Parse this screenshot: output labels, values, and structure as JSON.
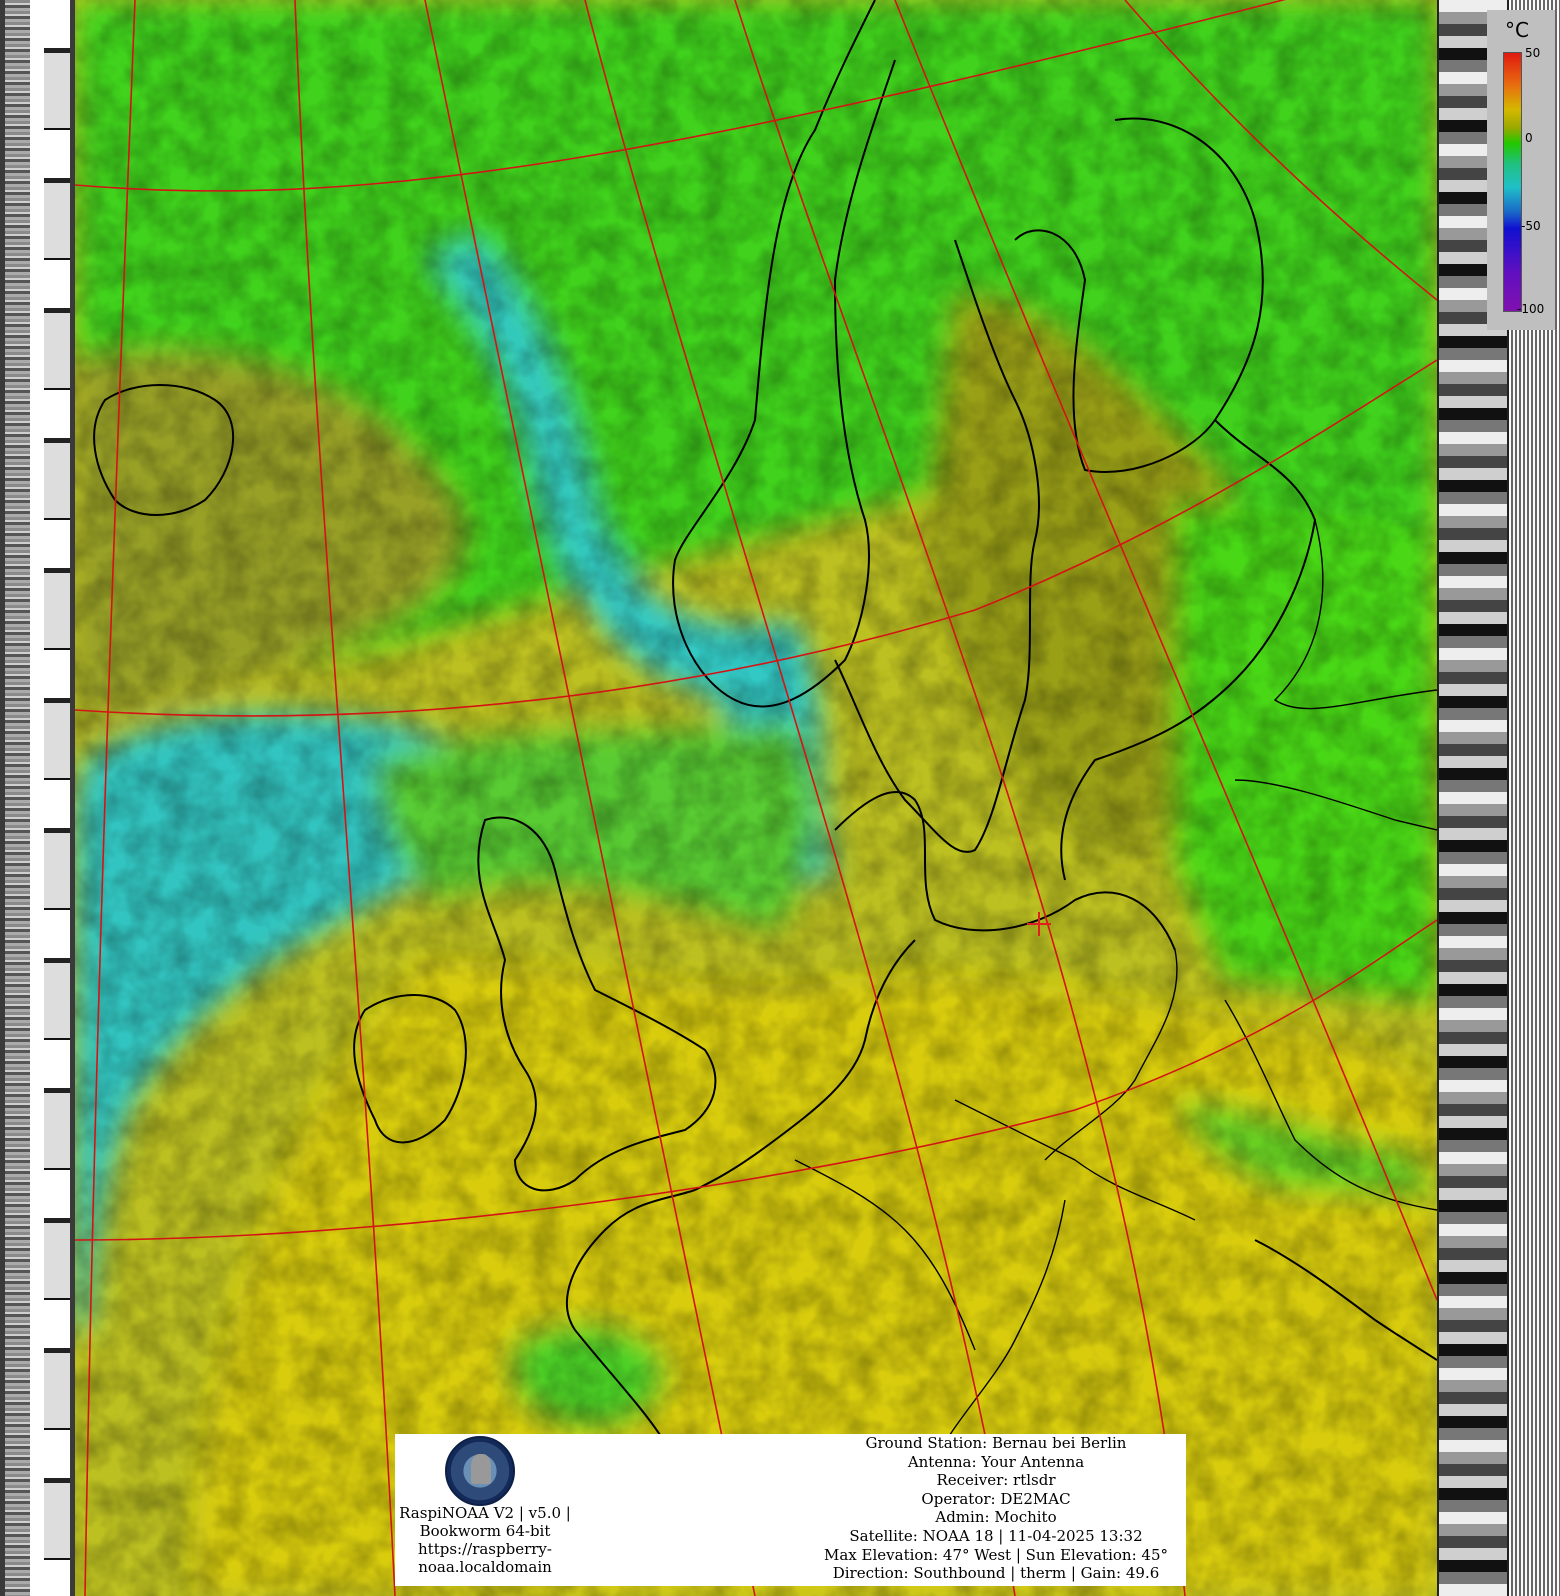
{
  "legend": {
    "unit": "°C",
    "ticks": [
      "50",
      "0",
      "-50",
      "-100"
    ],
    "color_scale": [
      "#e01a10",
      "#d4b800",
      "#22c800",
      "#20c0c8",
      "#1a64c8",
      "#8010b0"
    ]
  },
  "info": {
    "software": "RaspiNOAA V2 | v5.0 |",
    "os": "Bookworm 64-bit",
    "url_line1": "https://raspberry-",
    "url_line2": "noaa.localdomain",
    "ground_station": "Ground Station: Bernau bei Berlin",
    "antenna": "Antenna: Your Antenna",
    "receiver": "Receiver: rtlsdr",
    "operator": "Operator: DE2MAC",
    "admin": "Admin: Mochito",
    "satellite": "Satellite: NOAA 18 | 11-04-2025 13:32",
    "elevation": "Max Elevation: 47° West | Sun Elevation: 45°",
    "direction": "Direction: Southbound | therm | Gain: 49.6"
  },
  "colors": {
    "warm_yellow": "#d4c80a",
    "olive": "#9aa01a",
    "green": "#3fd21c",
    "cyan": "#2ec8c8",
    "blue": "#1e6ea8",
    "grid_red": "#d41414",
    "coast_black": "#000000"
  }
}
